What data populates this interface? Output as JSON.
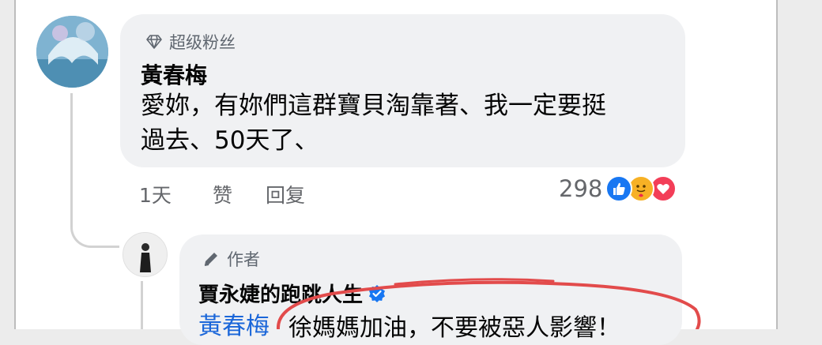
{
  "comment": {
    "badge_label": "超级粉丝",
    "author": "黃春梅",
    "text_line1": "愛妳，有妳們這群寶貝淘靠著、我一定要挺",
    "text_line2": "過去、50天了、",
    "time": "1天",
    "like_label": "赞",
    "reply_label": "回复",
    "reaction_count": "298",
    "reactions": [
      "like-reaction-icon",
      "care-reaction-icon",
      "love-reaction-icon"
    ]
  },
  "reply": {
    "badge_label": "作者",
    "author": "賈永婕的跑跳人生",
    "mention": "黃春梅",
    "text": "徐媽媽加油，不要被惡人影響！"
  },
  "colors": {
    "bubble": "#f0f1f3",
    "mention": "#1a66d9",
    "verified": "#1877f2",
    "annotation": "#e24b4b"
  }
}
